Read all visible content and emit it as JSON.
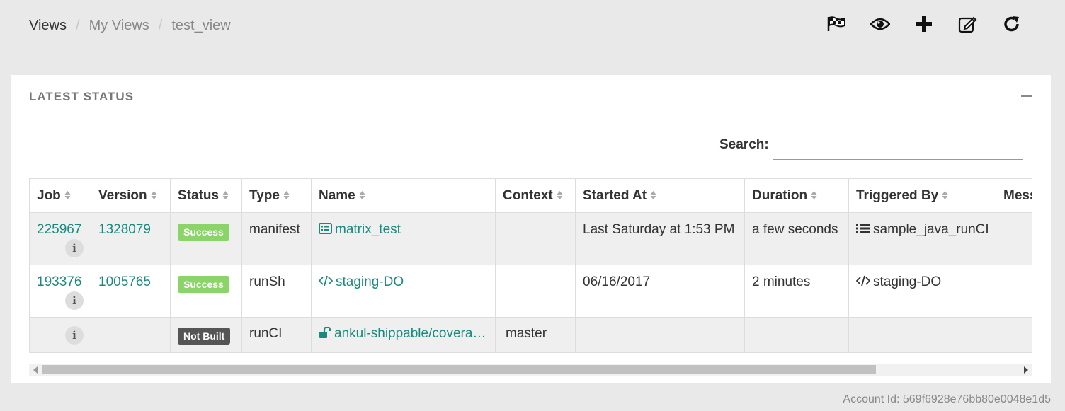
{
  "breadcrumb": {
    "items": [
      "Views",
      "My Views",
      "test_view"
    ]
  },
  "toolbar": {
    "icons": [
      "flag-icon",
      "eye-icon",
      "plus-icon",
      "edit-icon",
      "refresh-icon"
    ]
  },
  "panel": {
    "title": "LATEST STATUS"
  },
  "search": {
    "label": "Search:",
    "value": "",
    "placeholder": ""
  },
  "table": {
    "columns": [
      "Job",
      "Version",
      "Status",
      "Type",
      "Name",
      "Context",
      "Started At",
      "Duration",
      "Triggered By",
      "Mess"
    ],
    "rows": [
      {
        "job": "225967",
        "version": "1328079",
        "status": "Success",
        "type": "manifest",
        "name": "matrix_test",
        "name_icon": "list-alt-icon",
        "context": "",
        "started_at": "Last Saturday at 1:53 PM",
        "duration": "a few seconds",
        "triggered_by": "sample_java_runCI",
        "triggered_icon": "list-icon"
      },
      {
        "job": "193376",
        "version": "1005765",
        "status": "Success",
        "type": "runSh",
        "name": "staging-DO",
        "name_icon": "code-icon",
        "context": "",
        "started_at": "06/16/2017",
        "duration": "2 minutes",
        "triggered_by": "staging-DO",
        "triggered_icon": "code-icon"
      },
      {
        "job": "",
        "version": "",
        "status": "Not Built",
        "type": "runCI",
        "name": "ankul-shippable/covera…",
        "name_icon": "unlock-icon",
        "context": "master",
        "started_at": "",
        "duration": "",
        "triggered_by": "",
        "triggered_icon": ""
      }
    ]
  },
  "colors": {
    "link": "#1a8a7e",
    "success": "#8bd46a",
    "not_built": "#555555"
  },
  "footer": {
    "account": "Account Id: 569f6928e76bb80e0048e1d5"
  }
}
